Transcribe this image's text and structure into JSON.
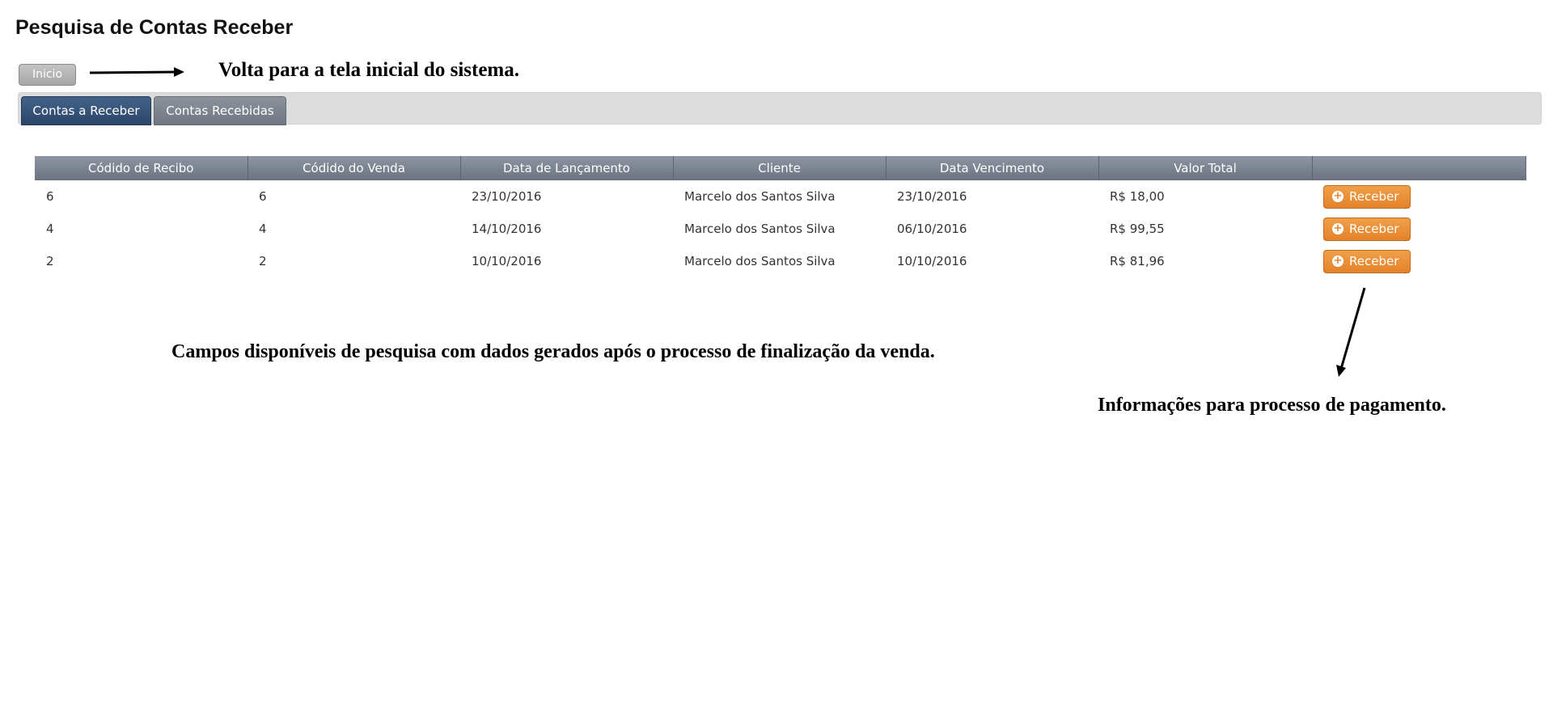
{
  "page": {
    "title": "Pesquisa de Contas Receber"
  },
  "toolbar": {
    "inicio_label": "Inicio"
  },
  "annotations": {
    "inicio": "Volta para a tela inicial do sistema.",
    "campos": "Campos disponíveis de pesquisa com dados gerados após o processo de finalização da venda.",
    "info": "Informações para processo de pagamento."
  },
  "tabs": [
    {
      "label": "Contas a Receber",
      "active": true
    },
    {
      "label": "Contas Recebidas",
      "active": false
    }
  ],
  "table": {
    "columns": [
      "Códido de Recibo",
      "Códido do Venda",
      "Data de Lançamento",
      "Cliente",
      "Data Vencimento",
      "Valor Total",
      ""
    ],
    "rows": [
      {
        "recibo": "6",
        "venda": "6",
        "lancamento": "23/10/2016",
        "cliente": "Marcelo dos Santos Silva",
        "vencimento": "23/10/2016",
        "valor": "R$ 18,00",
        "action": "Receber"
      },
      {
        "recibo": "4",
        "venda": "4",
        "lancamento": "14/10/2016",
        "cliente": "Marcelo dos Santos Silva",
        "vencimento": "06/10/2016",
        "valor": "R$ 99,55",
        "action": "Receber"
      },
      {
        "recibo": "2",
        "venda": "2",
        "lancamento": "10/10/2016",
        "cliente": "Marcelo dos Santos Silva",
        "vencimento": "10/10/2016",
        "valor": "R$ 81,96",
        "action": "Receber"
      }
    ]
  },
  "icons": {
    "action_icon": "plus-circle-icon"
  },
  "colors": {
    "tab_active": "#2b4668",
    "tab_inactive": "#6f7681",
    "header_bg": "#6b7280",
    "action_button": "#e2822a"
  }
}
